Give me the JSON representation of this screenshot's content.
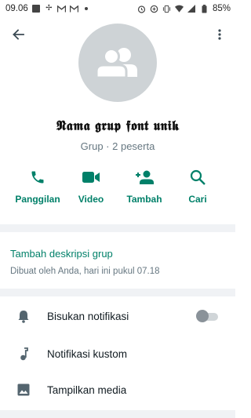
{
  "status_bar": {
    "time": "09.06",
    "battery": "85%"
  },
  "group": {
    "name": "𝕹𝖆𝖒𝖆 𝖌𝖗𝖚𝖕 𝖋𝖔𝖓𝖙 𝖚𝖓𝖎𝖐",
    "meta": "Grup · 2 peserta"
  },
  "actions": [
    {
      "label": "Panggilan",
      "icon": "phone-icon"
    },
    {
      "label": "Video",
      "icon": "video-icon"
    },
    {
      "label": "Tambah",
      "icon": "add-person-icon"
    },
    {
      "label": "Cari",
      "icon": "search-icon"
    }
  ],
  "description": {
    "link": "Tambah deskripsi grup",
    "created": "Dibuat oleh Anda, hari ini pukul 07.18"
  },
  "settings": [
    {
      "label": "Bisukan notifikasi",
      "icon": "bell-icon"
    },
    {
      "label": "Notifikasi kustom",
      "icon": "music-note-icon"
    },
    {
      "label": "Tampilkan media",
      "icon": "image-icon"
    }
  ],
  "colors": {
    "accent": "#008069",
    "avatar_bg": "#ced3d6",
    "divider": "#f0f2f5",
    "secondary_text": "#667781"
  }
}
